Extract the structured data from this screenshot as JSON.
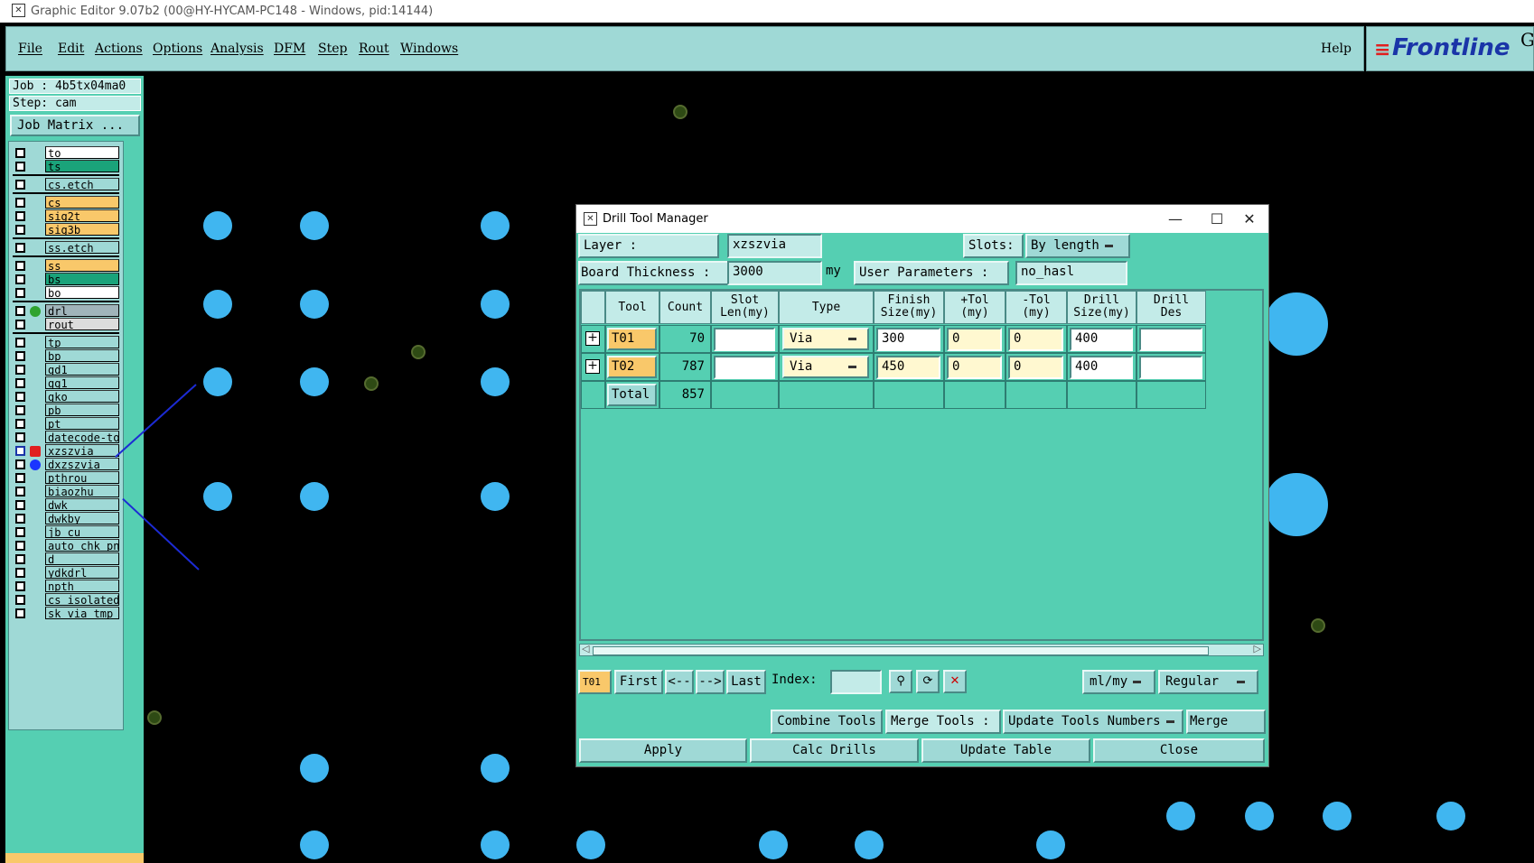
{
  "window": {
    "title": "Graphic Editor 9.07b2 (00@HY-HYCAM-PC148 - Windows, pid:14144)"
  },
  "menu": {
    "items": [
      "File",
      "Edit",
      "Actions",
      "Options",
      "Analysis",
      "DFM",
      "Step",
      "Rout",
      "Windows"
    ],
    "help": "Help"
  },
  "logo": {
    "mark": "≡",
    "text": "Frontline",
    "suffix": "G"
  },
  "job": {
    "job_line": "Job  : 4b5tx04ma0",
    "step_line": "Step: cam",
    "matrix_button": "Job Matrix ..."
  },
  "layers": [
    {
      "name": "to",
      "color": "#ffffff"
    },
    {
      "name": "ts",
      "color": "#1aa37a"
    },
    {
      "name": "cs.etch",
      "color": "#9fd9d6"
    },
    {
      "name": "cs",
      "color": "#f9c86a"
    },
    {
      "name": "sig2t",
      "color": "#f9c86a"
    },
    {
      "name": "sig3b",
      "color": "#f9c86a"
    },
    {
      "name": "ss.etch",
      "color": "#9fd9d6"
    },
    {
      "name": "ss",
      "color": "#f9c86a"
    },
    {
      "name": "bs",
      "color": "#1aa37a"
    },
    {
      "name": "bo",
      "color": "#ffffff"
    },
    {
      "name": "drl",
      "color": "#a0b4ba"
    },
    {
      "name": "rout",
      "color": "#dcdcdc"
    },
    {
      "name": "tp",
      "color": "#9fd9d6"
    },
    {
      "name": "bp",
      "color": "#9fd9d6"
    },
    {
      "name": "gd1",
      "color": "#9fd9d6"
    },
    {
      "name": "gg1",
      "color": "#9fd9d6"
    },
    {
      "name": "gko",
      "color": "#9fd9d6"
    },
    {
      "name": "pb",
      "color": "#9fd9d6"
    },
    {
      "name": "pt",
      "color": "#9fd9d6"
    },
    {
      "name": "datecode-to",
      "color": "#9fd9d6"
    },
    {
      "name": "xzszvia",
      "color": "#9fd9d6"
    },
    {
      "name": "dxzszvia",
      "color": "#9fd9d6"
    },
    {
      "name": "pthrou",
      "color": "#9fd9d6"
    },
    {
      "name": "biaozhu",
      "color": "#9fd9d6"
    },
    {
      "name": "dwk",
      "color": "#9fd9d6"
    },
    {
      "name": "dwkby",
      "color": "#9fd9d6"
    },
    {
      "name": "jb_cu",
      "color": "#9fd9d6"
    },
    {
      "name": "auto_chk_pn",
      "color": "#9fd9d6"
    },
    {
      "name": "d",
      "color": "#9fd9d6"
    },
    {
      "name": "ydkdrl",
      "color": "#9fd9d6"
    },
    {
      "name": "npth",
      "color": "#9fd9d6"
    },
    {
      "name": "cs_isolated",
      "color": "#9fd9d6"
    },
    {
      "name": "sk_via_tmp",
      "color": "#9fd9d6"
    }
  ],
  "dialog": {
    "title": "Drill Tool Manager",
    "layer_label": "Layer          :",
    "layer_value": "xzszvia",
    "slots_label": "Slots:",
    "slots_value": "By length",
    "board_thickness_label": "Board Thickness :",
    "board_thickness_value": "3000",
    "board_thickness_unit": "my",
    "user_params_label": "User Parameters :",
    "user_params_value": "no_hasl",
    "columns": [
      {
        "l1": "Tool",
        "l2": ""
      },
      {
        "l1": "Count",
        "l2": ""
      },
      {
        "l1": "Slot",
        "l2": "Len(my)"
      },
      {
        "l1": "Type",
        "l2": ""
      },
      {
        "l1": "Finish",
        "l2": "Size(my)"
      },
      {
        "l1": "+Tol",
        "l2": "(my)"
      },
      {
        "l1": "-Tol",
        "l2": "(my)"
      },
      {
        "l1": "Drill",
        "l2": "Size(my)"
      },
      {
        "l1": "Drill",
        "l2": "Des"
      }
    ],
    "rows": [
      {
        "tool": "T01",
        "count": "70",
        "slot_len": "",
        "type": "Via",
        "finish": "300",
        "ptol": "0",
        "ntol": "0",
        "drill": "400",
        "des": ""
      },
      {
        "tool": "T02",
        "count": "787",
        "slot_len": "",
        "type": "Via",
        "finish": "450",
        "ptol": "0",
        "ntol": "0",
        "drill": "400",
        "des": ""
      }
    ],
    "total_label": "Total",
    "total_count": "857",
    "nav": {
      "current": "T01",
      "first": "First",
      "prev": "<--",
      "next": "-->",
      "last": "Last",
      "index_label": "Index:",
      "units": "ml/my",
      "mode": "Regular"
    },
    "actions": {
      "combine": "Combine Tools",
      "merge_tools": "Merge Tools :",
      "update_numbers": "Update Tools Numbers",
      "merge": "Merge",
      "apply": "Apply",
      "calc": "Calc Drills",
      "update_table": "Update Table",
      "close": "Close"
    }
  },
  "colors": {
    "panel": "#55cfb2",
    "light": "#9fd9d6",
    "pad": "#40b6f0",
    "highlight": "#f9c86a",
    "arrow": "#1c2bd4"
  }
}
